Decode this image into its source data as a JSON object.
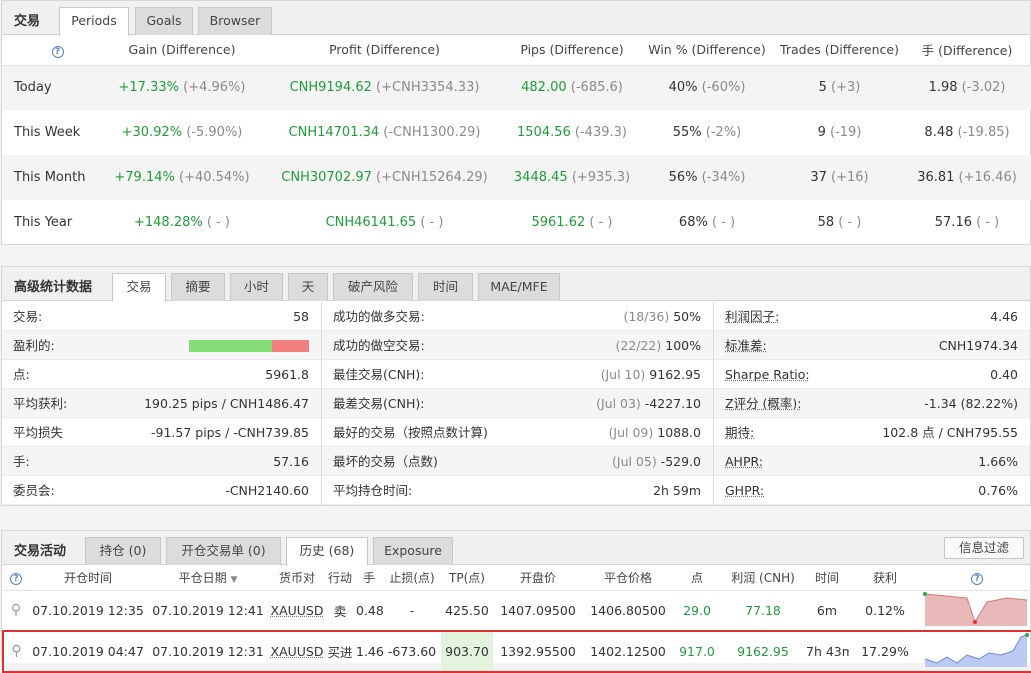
{
  "periods": {
    "title": "交易",
    "tabs": [
      "Periods",
      "Goals",
      "Browser"
    ],
    "columns": [
      "Gain (Difference)",
      "Profit (Difference)",
      "Pips (Difference)",
      "Win % (Difference)",
      "Trades (Difference)",
      "手 (Difference)"
    ],
    "rows": [
      {
        "label": "Today",
        "gain": "+17.33%",
        "gain_diff": "(+4.96%)",
        "profit": "CNH9194.62",
        "profit_diff": "(+CNH3354.33)",
        "pips": "482.00",
        "pips_diff": "(-685.6)",
        "win": "40%",
        "win_diff": "(-60%)",
        "trades": "5",
        "trades_diff": "(+3)",
        "lots": "1.98",
        "lots_diff": "(-3.02)"
      },
      {
        "label": "This Week",
        "gain": "+30.92%",
        "gain_diff": "(-5.90%)",
        "profit": "CNH14701.34",
        "profit_diff": "(-CNH1300.29)",
        "pips": "1504.56",
        "pips_diff": "(-439.3)",
        "win": "55%",
        "win_diff": "(-2%)",
        "trades": "9",
        "trades_diff": "(-19)",
        "lots": "8.48",
        "lots_diff": "(-19.85)"
      },
      {
        "label": "This Month",
        "gain": "+79.14%",
        "gain_diff": "(+40.54%)",
        "profit": "CNH30702.97",
        "profit_diff": "(+CNH15264.29)",
        "pips": "3448.45",
        "pips_diff": "(+935.3)",
        "win": "56%",
        "win_diff": "(-34%)",
        "trades": "37",
        "trades_diff": "(+16)",
        "lots": "36.81",
        "lots_diff": "(+16.46)"
      },
      {
        "label": "This Year",
        "gain": "+148.28%",
        "gain_diff": "( - )",
        "profit": "CNH46141.65",
        "profit_diff": "( - )",
        "pips": "5961.62",
        "pips_diff": "( - )",
        "win": "68%",
        "win_diff": "( - )",
        "trades": "58",
        "trades_diff": "( - )",
        "lots": "57.16",
        "lots_diff": "( - )"
      }
    ]
  },
  "advanced": {
    "title": "高级统计数据",
    "tabs": [
      "交易",
      "摘要",
      "小时",
      "天",
      "破产风险",
      "时间",
      "MAE/MFE"
    ],
    "col1": [
      {
        "k": "交易:",
        "v": "58"
      },
      {
        "k": "盈利的:",
        "v": ""
      },
      {
        "k": "点:",
        "v": "5961.8"
      },
      {
        "k": "平均获利:",
        "v": "190.25 pips / CNH1486.47"
      },
      {
        "k": "平均损失",
        "v": "-91.57 pips / -CNH739.85"
      },
      {
        "k": "手:",
        "v": "57.16"
      },
      {
        "k": "委员会:",
        "v": "-CNH2140.60"
      }
    ],
    "win_ratio": 0.69,
    "col2": [
      {
        "k": "成功的做多交易:",
        "d": "(18/36)",
        "v": "50%"
      },
      {
        "k": "成功的做空交易:",
        "d": "(22/22)",
        "v": "100%"
      },
      {
        "k": "最佳交易(CNH):",
        "d": "(Jul 10)",
        "v": "9162.95"
      },
      {
        "k": "最差交易(CNH):",
        "d": "(Jul 03)",
        "v": "-4227.10"
      },
      {
        "k": "最好的交易（按照点数计算)",
        "d": "(Jul 09)",
        "v": "1088.0"
      },
      {
        "k": "最坏的交易（点数)",
        "d": "(Jul 05)",
        "v": "-529.0"
      },
      {
        "k": "平均持仓时间:",
        "d": "",
        "v": "2h 59m"
      }
    ],
    "col3": [
      {
        "k": "利润因子:",
        "v": "4.46"
      },
      {
        "k": "标准差:",
        "v": "CNH1974.34"
      },
      {
        "k": "Sharpe Ratio:",
        "v": "0.40"
      },
      {
        "k": "Z评分 (概率):",
        "v": "-1.34 (82.22%)"
      },
      {
        "k": "期待:",
        "v": "102.8 点 / CNH795.55"
      },
      {
        "k": "AHPR:",
        "v": "1.66%"
      },
      {
        "k": "GHPR:",
        "v": "0.76%"
      }
    ]
  },
  "activity": {
    "title": "交易活动",
    "tabs": [
      "持仓 (0)",
      "开仓交易单 (0)",
      "历史 (68)",
      "Exposure"
    ],
    "filter_label": "信息过滤",
    "columns": [
      "开仓时间",
      "平仓日期",
      "货币对",
      "行动",
      "手",
      "止损(点)",
      "TP(点)",
      "开盘价",
      "平仓价格",
      "点",
      "利润 (CNH)",
      "时间",
      "获利"
    ],
    "sort_indicator": "▼",
    "rows": [
      {
        "open": "07.10.2019 12:35",
        "close": "07.10.2019 12:41",
        "symbol": "XAUUSD",
        "action": "卖",
        "lots": "0.48",
        "sl": "-",
        "tp": "425.50",
        "open_price": "1407.09500",
        "close_price": "1406.80500",
        "pips": "29.0",
        "profit": "77.18",
        "duration": "6m",
        "gain": "0.12%"
      },
      {
        "open": "07.10.2019 04:47",
        "close": "07.10.2019 12:31",
        "symbol": "XAUUSD",
        "action": "买进",
        "lots": "1.46",
        "sl": "-673.60",
        "tp": "903.70",
        "open_price": "1392.95500",
        "close_price": "1402.12500",
        "pips": "917.0",
        "profit": "9162.95",
        "duration": "7h 43m",
        "gain": "17.29%"
      }
    ]
  },
  "icons": {
    "help": "question-circle-icon",
    "attach": "paperclip-icon"
  },
  "colors": {
    "positive": "#1f9c3b",
    "muted": "#8a8a8a",
    "highlight": "#e03030",
    "win_bar": "#85dd75",
    "loss_bar": "#f28080"
  }
}
